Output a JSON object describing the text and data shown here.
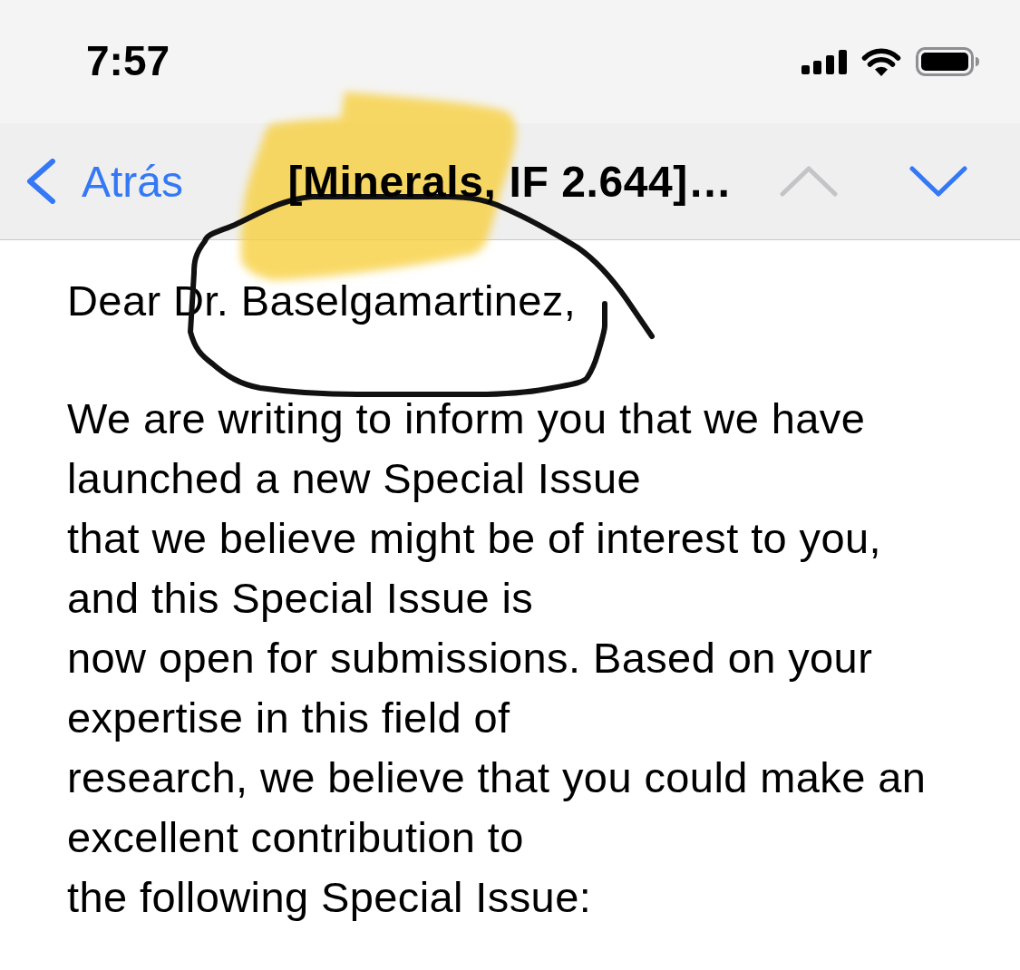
{
  "status_bar": {
    "time": "7:57"
  },
  "nav_bar": {
    "back_label": "Atrás",
    "title": "[Minerals, IF 2.644]…",
    "previous_message": {
      "disabled": true
    },
    "next_message": {
      "disabled": false
    }
  },
  "email_body": {
    "greeting": "Dear Dr. Baselgamartinez,",
    "paragraph_lines": [
      "We are writing to inform you that we have",
      "launched a new Special Issue",
      "that we believe might be of interest to you,",
      "and this Special Issue is",
      "now open for submissions. Based on your",
      "expertise in this field of",
      "research, we believe that you could make an",
      "excellent contribution to",
      "the following Special Issue:"
    ]
  },
  "annotations": [
    {
      "kind": "highlight"
    },
    {
      "kind": "loop"
    }
  ]
}
